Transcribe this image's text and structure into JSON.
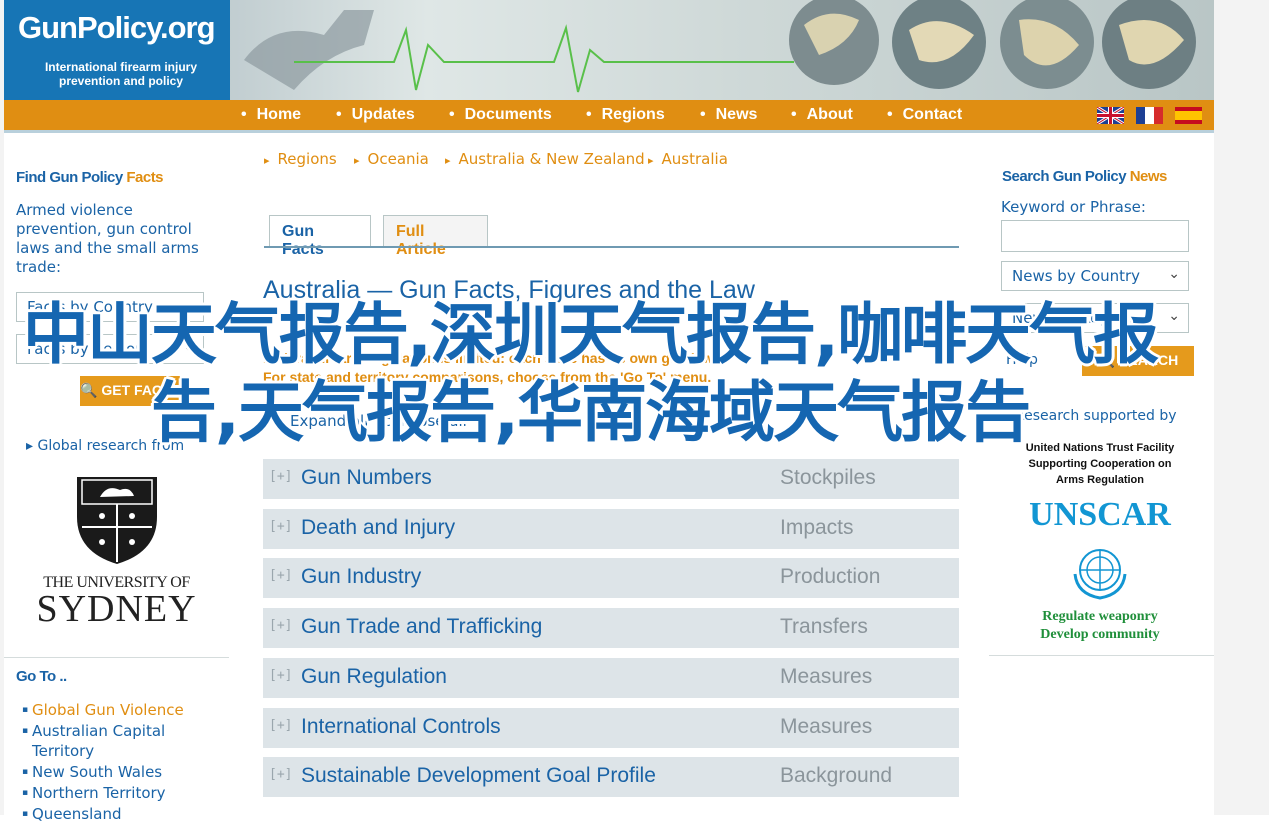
{
  "header": {
    "logo_title": "GunPolicy.org",
    "logo_subtitle": "International firearm injury prevention and policy"
  },
  "nav": {
    "items": [
      "Home",
      "Updates",
      "Documents",
      "Regions",
      "News",
      "About",
      "Contact"
    ],
    "flags": [
      "uk-flag-icon",
      "france-flag-icon",
      "spain-flag-icon"
    ]
  },
  "left_sidebar": {
    "find_title": "Find Gun Policy",
    "find_title_accent": "Facts",
    "find_description": "Armed violence prevention, gun control laws and the small arms trade:",
    "select_country": "Facts by Country",
    "select_region": "Facts by Region",
    "button_label": "GET FACTS",
    "research_note": "Global research from",
    "university_line1": "THE UNIVERSITY OF",
    "university_line2": "SYDNEY",
    "goto_title": "Go To ..",
    "goto_items": [
      {
        "label": "Global Gun Violence",
        "active": true
      },
      {
        "label": "Australian Capital Territory",
        "active": false
      },
      {
        "label": "New South Wales",
        "active": false
      },
      {
        "label": "Northern Territory",
        "active": false
      },
      {
        "label": "Queensland",
        "active": false
      }
    ]
  },
  "breadcrumb": [
    "Regions",
    "Oceania",
    "Australia & New Zealand",
    "Australia"
  ],
  "tabs": [
    "Gun Facts",
    "Full Article"
  ],
  "main": {
    "title": "Australia — Gun Facts, Figures and the Law",
    "note_line1": "Federal firearm regulation is limited: each state has its own gun law.",
    "note_line2": "For state and territory comparisons, choose from the 'Go To' menu.",
    "expand_collapse": "Expand all | collapse all",
    "rows": [
      {
        "label": "Gun Numbers",
        "sub": "Stockpiles"
      },
      {
        "label": "Death and Injury",
        "sub": "Impacts"
      },
      {
        "label": "Gun Industry",
        "sub": "Production"
      },
      {
        "label": "Gun Trade and Trafficking",
        "sub": "Transfers"
      },
      {
        "label": "Gun Regulation",
        "sub": "Measures"
      },
      {
        "label": "International Controls",
        "sub": "Measures"
      },
      {
        "label": "Sustainable Development Goal Profile",
        "sub": "Background"
      }
    ],
    "expand_icon": "[+]"
  },
  "right_sidebar": {
    "search_title": "Search Gun Policy",
    "search_title_accent": "News",
    "keyword_label": "Keyword or Phrase:",
    "keyword_value": "",
    "select_country": "News by Country",
    "select_region": "News by Region",
    "search_button": "SEARCH",
    "help_link": "Help",
    "research_note": "Research supported by",
    "unscar_line1": "United Nations Trust Facility",
    "unscar_line2": "Supporting Cooperation on",
    "unscar_line3": "Arms Regulation",
    "unscar_name": "UNSCAR",
    "unscar_tag1": "Regulate weaponry",
    "unscar_tag2": "Develop community"
  },
  "overlay_text": "中山天气报告,深圳天气报告,咖啡天气报告,天气报告,华南海域天气报告",
  "colors": {
    "brand_blue": "#1775b5",
    "nav_orange": "#e08e12",
    "link_blue": "#1a63a6",
    "row_bg": "#dde4e8"
  }
}
